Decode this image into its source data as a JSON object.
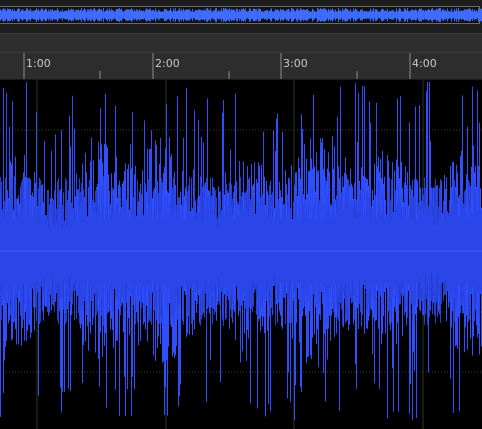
{
  "overview": {
    "wave_color": "#3f6cff"
  },
  "ruler": {
    "ticks": [
      {
        "label": "1:00"
      },
      {
        "label": "2:00"
      },
      {
        "label": "3:00"
      },
      {
        "label": "4:00"
      }
    ]
  },
  "waveform": {
    "color": "#2f4fff",
    "gridline_color": "#3a3a3a",
    "baseline_color": "#4a6bff"
  }
}
